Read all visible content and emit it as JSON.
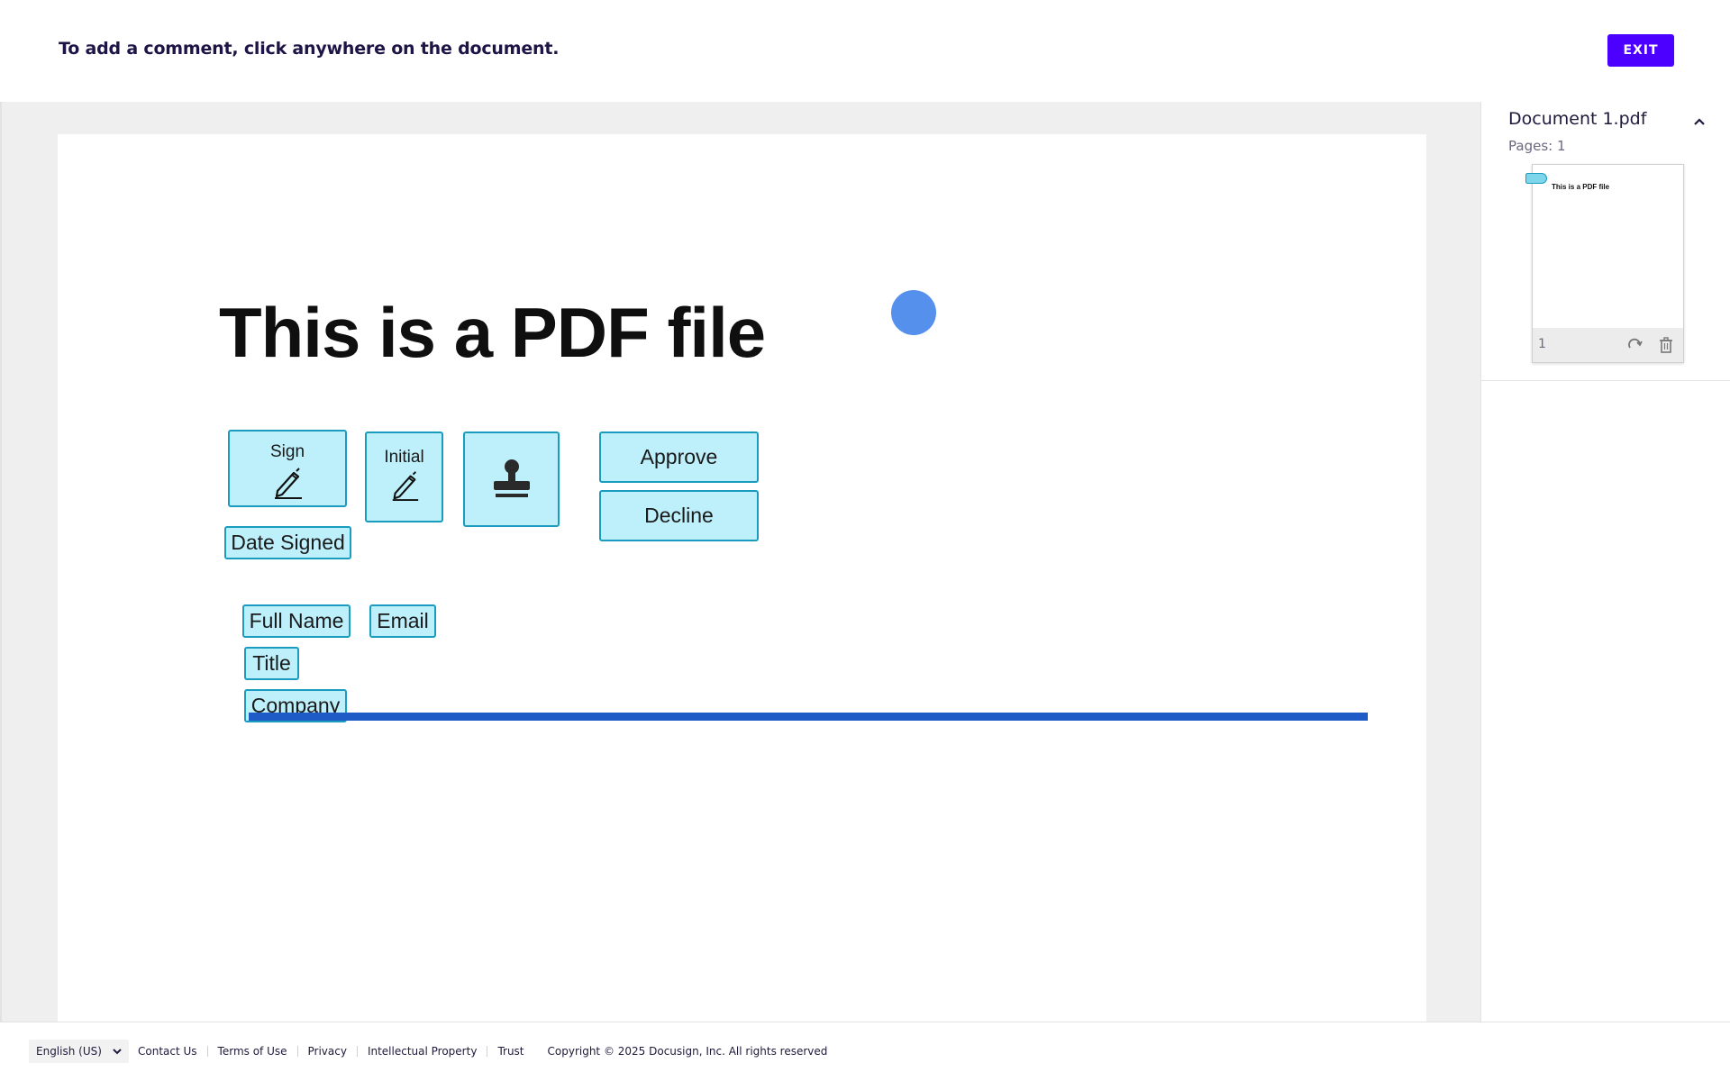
{
  "topbar": {
    "instruction": "To add a comment, click anywhere on the document.",
    "exit_label": "EXIT"
  },
  "document": {
    "heading": "This is a PDF file",
    "fields": {
      "sign": "Sign",
      "initial": "Initial",
      "approve": "Approve",
      "decline": "Decline",
      "date_signed": "Date Signed",
      "full_name": "Full Name",
      "email": "Email",
      "title": "Title",
      "company": "Company"
    },
    "icons": [
      "pen-icon",
      "pen-icon",
      "stamp-icon"
    ],
    "colors": {
      "field_fill": "#bdf0fb",
      "field_border": "#1a9cbf",
      "rule": "#1e5bc6",
      "dot": "#5591ec"
    }
  },
  "side_panel": {
    "doc_name": "Document 1.pdf",
    "pages_label": "Pages: 1",
    "thumbnail": {
      "title": "This is a PDF file",
      "page_number": "1"
    }
  },
  "footer": {
    "language": "English (US)",
    "links": [
      "Contact Us",
      "Terms of Use",
      "Privacy",
      "Intellectual Property",
      "Trust"
    ],
    "copyright": "Copyright © 2025 Docusign, Inc. All rights reserved"
  },
  "accent_color": "#4c00ff"
}
